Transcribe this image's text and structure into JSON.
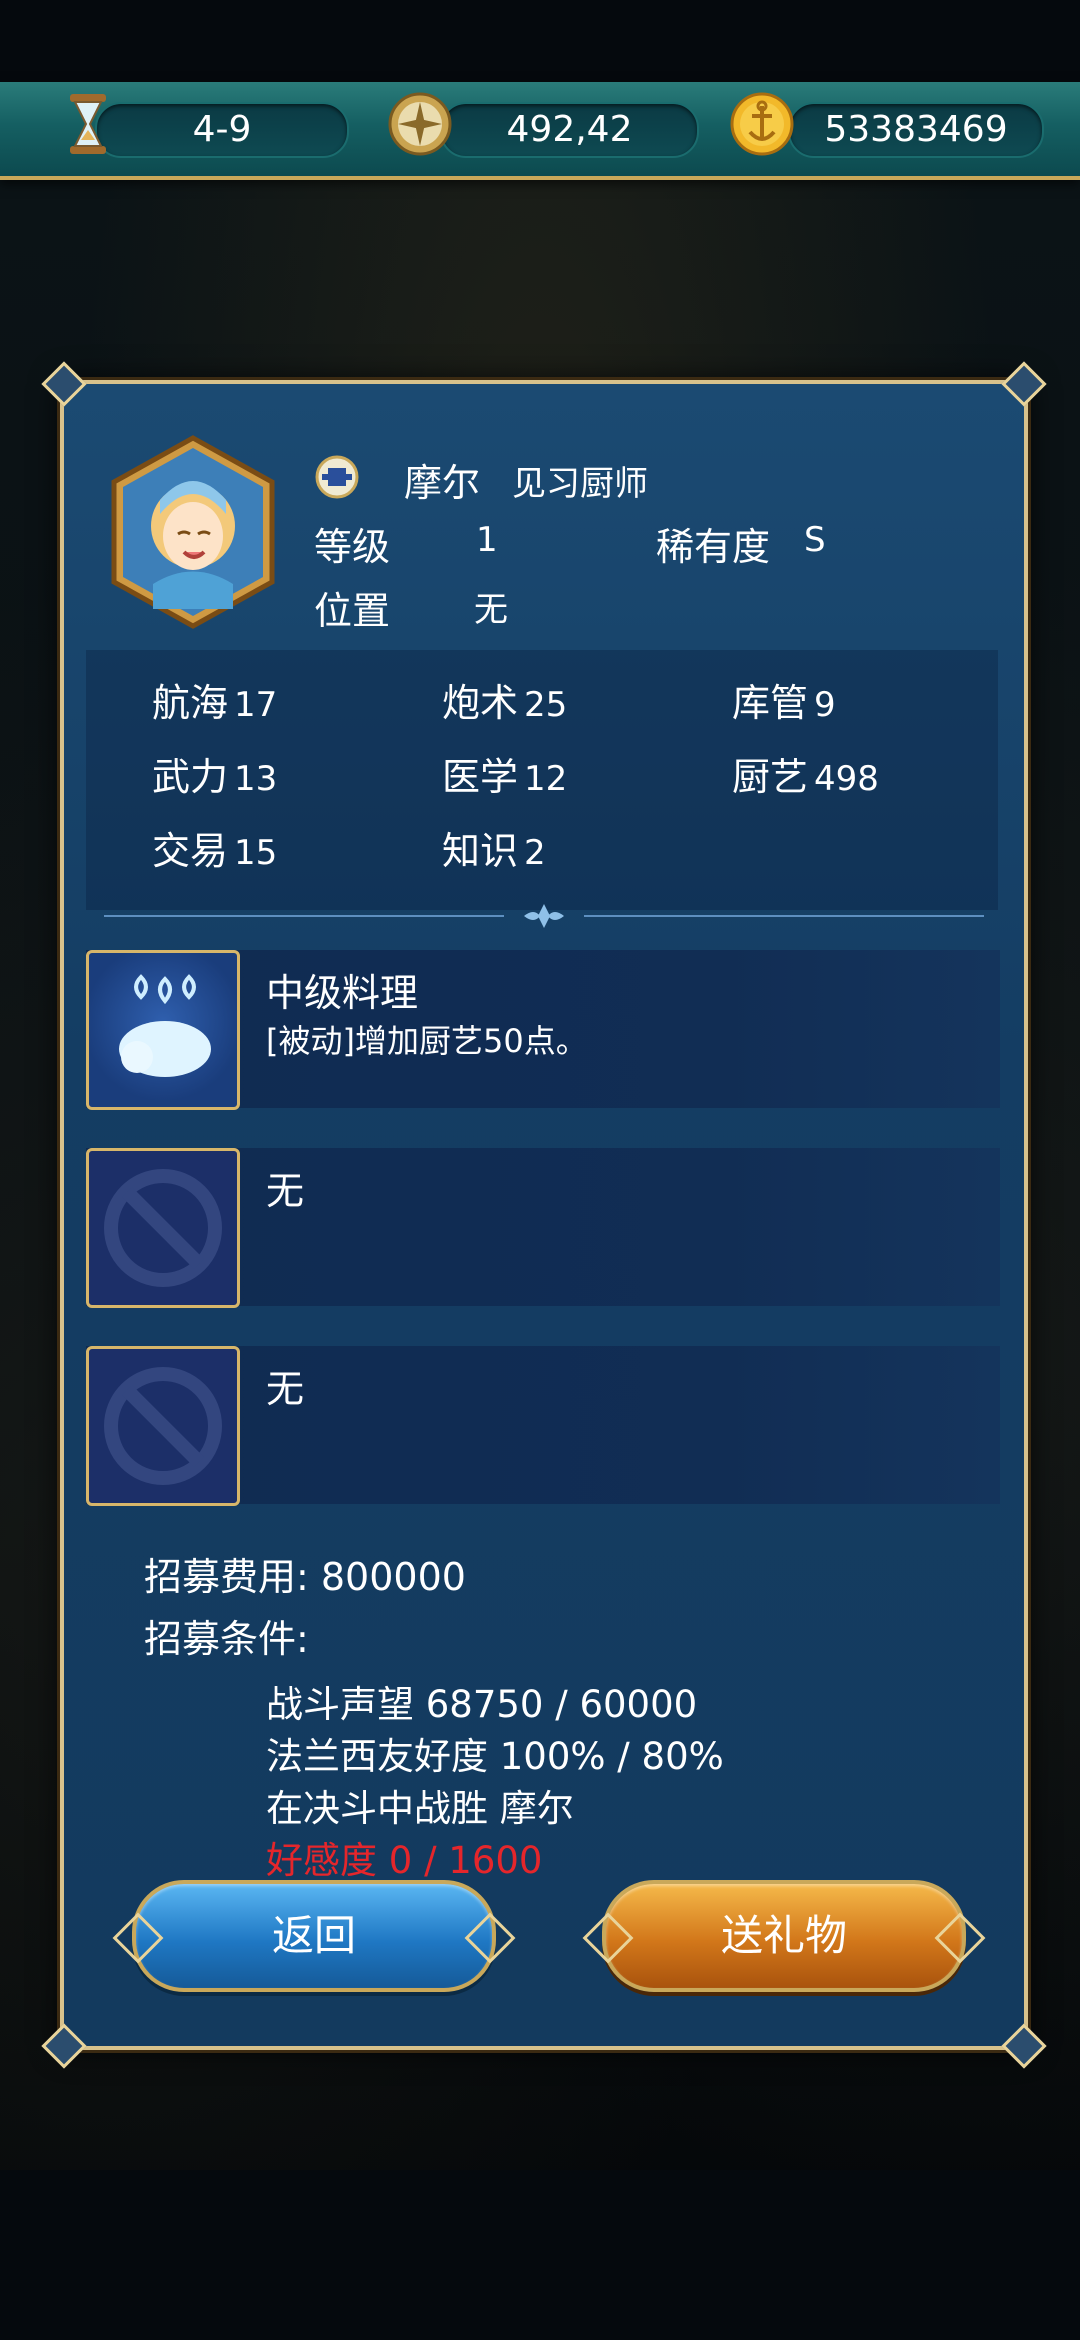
{
  "resources": {
    "hourglass_value": "4-9",
    "compass_value": "492,42",
    "gold_value": "53383469",
    "icons": [
      "hourglass-icon",
      "compass-icon",
      "gold-coin-icon"
    ]
  },
  "character": {
    "name": "摩尔",
    "title": "见习厨师",
    "level_label": "等级",
    "level_value": "1",
    "rarity_label": "稀有度",
    "rarity_value": "S",
    "position_label": "位置",
    "position_value": "无"
  },
  "stats": [
    {
      "label": "航海",
      "value": "17"
    },
    {
      "label": "炮术",
      "value": "25"
    },
    {
      "label": "库管",
      "value": "9"
    },
    {
      "label": "武力",
      "value": "13"
    },
    {
      "label": "医学",
      "value": "12"
    },
    {
      "label": "厨艺",
      "value": "498"
    },
    {
      "label": "交易",
      "value": "15"
    },
    {
      "label": "知识",
      "value": "2"
    }
  ],
  "skills": [
    {
      "name": "中级料理",
      "desc": "[被动]增加厨艺50点。",
      "icon": "roast-chicken-icon"
    },
    {
      "name": "无",
      "desc": "",
      "icon": "prohibited-icon"
    },
    {
      "name": "无",
      "desc": "",
      "icon": "prohibited-icon"
    }
  ],
  "recruit": {
    "cost_label": "招募费用: 800000",
    "conditions_label": "招募条件:",
    "conditions": [
      "战斗声望 68750 / 60000",
      "法兰西友好度 100% / 80%",
      "在决斗中战胜  摩尔",
      "好感度 0 / 1600"
    ],
    "unmet_color": "#e5262b"
  },
  "buttons": {
    "back_label": "返回",
    "gift_label": "送礼物"
  }
}
